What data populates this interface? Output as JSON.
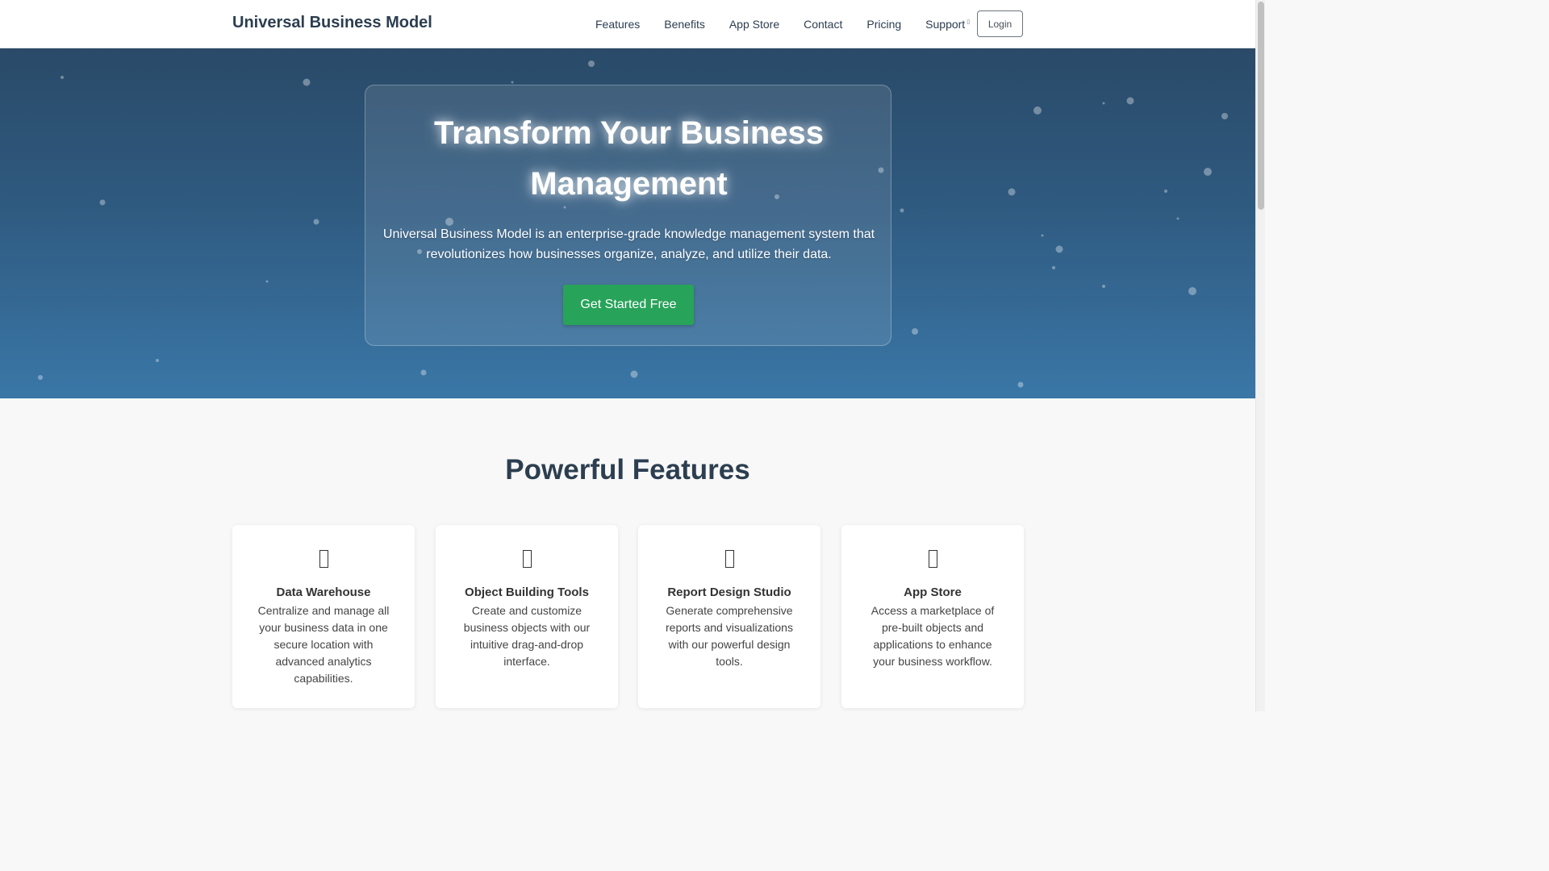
{
  "navbar": {
    "brand": "Universal Business Model",
    "links": [
      "Features",
      "Benefits",
      "App Store",
      "Contact",
      "Pricing",
      "Support"
    ],
    "support_caret_icon": "caret-icon",
    "login_label": "Login"
  },
  "hero": {
    "title": "Transform Your Business Management",
    "description": "Universal Business Model is an enterprise-grade knowledge management system that revolutionizes how businesses organize, analyze, and utilize their data.",
    "cta_label": "Get Started Free"
  },
  "features": {
    "title": "Powerful Features",
    "items": [
      {
        "icon": "database-icon",
        "name": "Data Warehouse",
        "description": "Centralize and manage all your business data in one secure location with advanced analytics capabilities."
      },
      {
        "icon": "tools-icon",
        "name": "Object Building Tools",
        "description": "Create and customize business objects with our intuitive drag-and-drop interface."
      },
      {
        "icon": "chart-icon",
        "name": "Report Design Studio",
        "description": "Generate comprehensive reports and visualizations with our powerful design tools."
      },
      {
        "icon": "store-icon",
        "name": "App Store",
        "description": "Access a marketplace of pre-built objects and applications to enhance your business workflow."
      }
    ]
  },
  "colors": {
    "brand": "#2c3e50",
    "cta": "#28a35a",
    "hero_top": "#2a4a68",
    "hero_bottom": "#3a77a7"
  }
}
